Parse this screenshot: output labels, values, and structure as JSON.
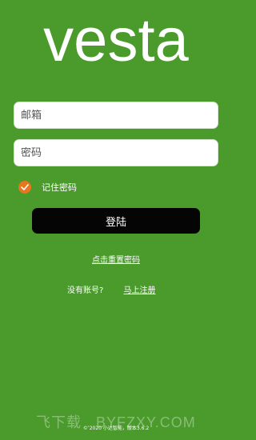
{
  "brand": {
    "logo_text": "vesta",
    "background_color": "#4a9a2c"
  },
  "form": {
    "email_placeholder": "邮箱",
    "password_placeholder": "密码",
    "remember_label": "记住密码",
    "remember_checked": true,
    "checkbox_color": "#e8761d",
    "login_label": "登陆"
  },
  "links": {
    "reset_password": "点击重置密码",
    "no_account": "没有账号?",
    "register": "马上注册"
  },
  "footer": {
    "copyright": "© 2020 小达智能，版本3.6.2"
  },
  "watermark": {
    "text": "飞下载 . BYFZXY.COM"
  }
}
